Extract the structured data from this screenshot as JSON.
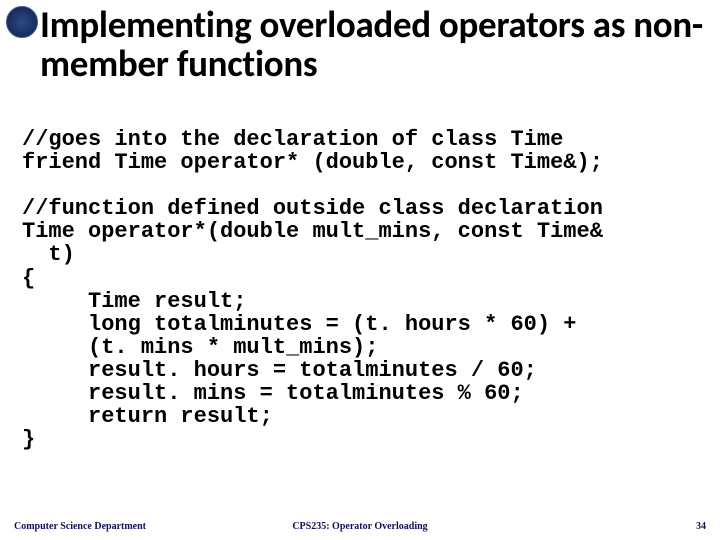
{
  "seal_alt": "institution-seal",
  "title": "Implementing overloaded operators as non-member functions",
  "code_lines": [
    "//goes into the declaration of class Time",
    "friend Time operator* (double, const Time&);",
    "",
    "//function defined outside class declaration",
    "Time operator*(double mult_mins, const Time&",
    "  t)",
    "{",
    "     Time result;",
    "     long totalminutes = (t. hours * 60) +",
    "     (t. mins * mult_mins);",
    "     result. hours = totalminutes / 60;",
    "     result. mins = totalminutes % 60;",
    "     return result;",
    "}"
  ],
  "footer": {
    "left": "Computer Science Department",
    "center": "CPS235: Operator Overloading",
    "right": "34"
  }
}
